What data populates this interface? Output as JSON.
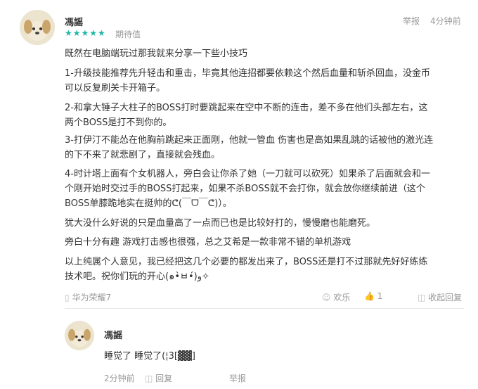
{
  "review": {
    "username": "馮謡",
    "stars": "★★★★★",
    "rating_label": "期待值",
    "report": "举报",
    "time": "4分钟前",
    "paragraphs": [
      "既然在电脑端玩过那我就来分享一下些小技巧",
      "1-升级技能推荐先升轻击和重击，毕竟其他连招都要依赖这个然后血量和斩杀回血，没金币",
      "可以反复刷关卡开箱子。",
      "2-和拿大锤子大柱子的BOSS打时要跳起来在空中不断的连击，差不多在他们头部左右，这",
      "两个BOSS是打不到你的。",
      "3-打伊汀不能怂在他胸前跳起来正面刚，他就一管血 伤害也是高如果乱跳的话被他的激光连",
      "的下不来了就悲剧了，直接就会残血。",
      "4-时计塔上面有个女机器人，旁白会让你杀了她（一刀就可以砍死）如果杀了后面就会和一",
      "个刚开始时交过手的BOSS打起来，如果不杀BOSS就不会打你，就会放你继续前进（这个",
      "BOSS单膝跪地实在挺帅的ᕦ(￣ᗜ￣ᕦ)）。",
      "犹大没什么好说的只是血量高了一点而已也是比较好打的，慢慢磨也能磨死。",
      "旁白十分有趣 游戏打击感也很强，总之艾希是一款非常不错的单机游戏",
      "以上纯属个人意见，我已经把这几个必要的都发出来了，BOSS还是打不过那就先好好练练",
      "技术吧。祝你们玩的开心(๑•̀ㅂ•́)و✧"
    ],
    "device": "华为荣耀7",
    "happy": "欢乐",
    "likes": "1",
    "collapse": "收起回复"
  },
  "reply": {
    "username": "馮謡",
    "text": "睡觉了 睡觉了(¦3[▓▓]",
    "time": "2分钟前",
    "reply_label": "回复",
    "report": "举报"
  },
  "colors": {
    "accent": "#1fb7a6",
    "muted": "#999999",
    "text": "#333333"
  }
}
